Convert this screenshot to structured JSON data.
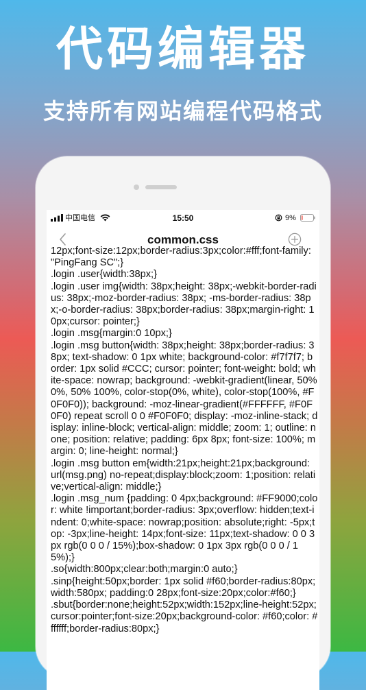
{
  "promo": {
    "title": "代码编辑器",
    "subtitle": "支持所有网站编程代码格式"
  },
  "status_bar": {
    "carrier": "中国电信",
    "time": "15:50",
    "battery_percent": "9%",
    "battery_level": 0.09,
    "battery_color": "#e8443a",
    "icons": [
      "signal-icon",
      "wifi-icon",
      "orientation-lock-icon",
      "battery-icon"
    ]
  },
  "nav": {
    "title": "common.css",
    "back_icon": "chevron-left-icon",
    "add_icon": "circle-plus-icon"
  },
  "editor": {
    "content": "12px;font-size:12px;border-radius:3px;color:#fff;font-family: \"PingFang SC\";}\n.login .user{width:38px;}\n.login .user img{width: 38px;height: 38px;-webkit-border-radius: 38px;-moz-border-radius: 38px; -ms-border-radius: 38px;-o-border-radius: 38px;border-radius: 38px;margin-right: 10px;cursor: pointer;}\n.login .msg{margin:0 10px;}\n.login .msg button{width: 38px;height: 38px;border-radius: 38px; text-shadow: 0 1px white; background-color: #f7f7f7; border: 1px solid #CCC; cursor: pointer; font-weight: bold; white-space: nowrap; background: -webkit-gradient(linear, 50% 0%, 50% 100%, color-stop(0%, white), color-stop(100%, #F0F0F0)); background: -moz-linear-gradient(#FFFFFF, #F0F0F0) repeat scroll 0 0 #F0F0F0; display: -moz-inline-stack; display: inline-block; vertical-align: middle; zoom: 1; outline: none; position: relative; padding: 6px 8px; font-size: 100%; margin: 0; line-height: normal;}\n.login .msg button em{width:21px;height:21px;background: url(msg.png) no-repeat;display:block;zoom: 1;position: relative;vertical-align: middle;}\n.login .msg_num {padding: 0 4px;background: #FF9000;color: white !important;border-radius: 3px;overflow: hidden;text-indent: 0;white-space: nowrap;position: absolute;right: -5px;top: -3px;line-height: 14px;font-size: 11px;text-shadow: 0 0 3px rgb(0 0 0 / 15%);box-shadow: 0 1px 3px rgb(0 0 0 / 15%);}\n.so{width:800px;clear:both;margin:0 auto;}\n.sinp{height:50px;border: 1px solid #f60;border-radius:80px;width:580px; padding:0 28px;font-size:20px;color:#f60;}\n.sbut{border:none;height:52px;width:152px;line-height:52px;cursor:pointer;font-size:20px;background-color: #f60;color: #ffffff;border-radius:80px;}"
  }
}
